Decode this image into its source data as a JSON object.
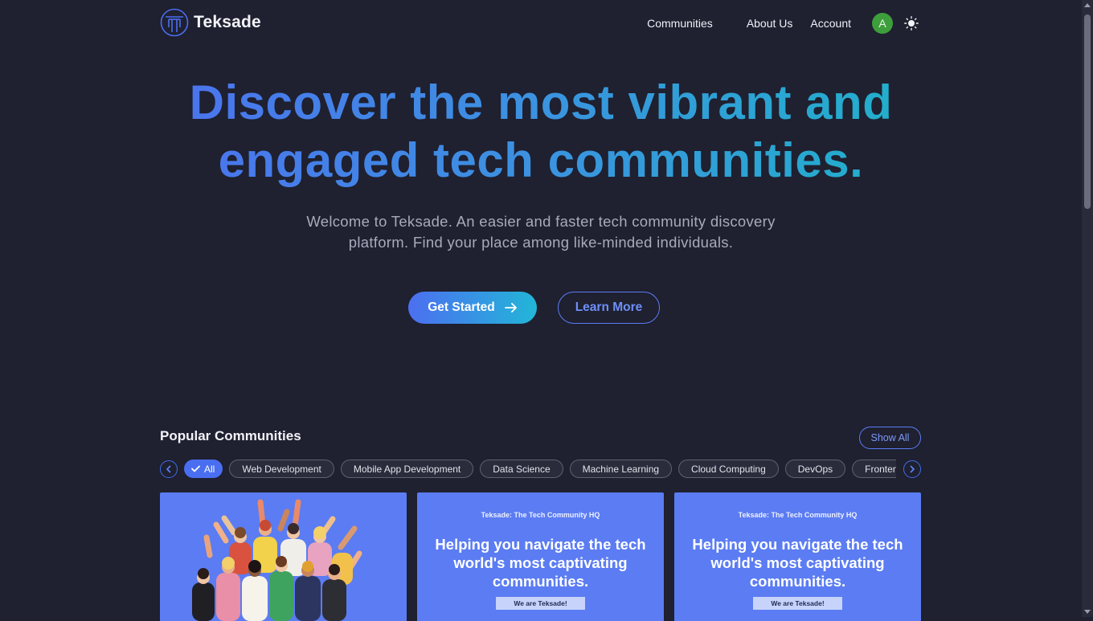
{
  "brand": {
    "name": "Teksade"
  },
  "nav": {
    "items": [
      "Communities",
      "About Us",
      "Account"
    ],
    "avatar_initial": "A"
  },
  "hero": {
    "title": "Discover the most vibrant and engaged tech communities.",
    "subtitle": "Welcome to Teksade. An easier and faster tech community discovery platform. Find your place among like-minded individuals.",
    "primary_cta": "Get Started",
    "secondary_cta": "Learn More"
  },
  "popular": {
    "title": "Popular Communities",
    "show_all": "Show All",
    "filters": [
      "All",
      "Web Development",
      "Mobile App Development",
      "Data Science",
      "Machine Learning",
      "Cloud Computing",
      "DevOps",
      "Frontend"
    ],
    "active_filter": "All",
    "cards": [
      {
        "type": "illustration"
      },
      {
        "kicker": "Teksade: The Tech Community HQ",
        "headline": "Helping you navigate the tech world's most captivating communities.",
        "tag": "We are Teksade!"
      },
      {
        "kicker": "Teksade: The Tech Community HQ",
        "headline": "Helping you navigate the tech world's most captivating communities.",
        "tag": "We are Teksade!"
      }
    ]
  },
  "colors": {
    "background": "#1f2030",
    "accent": "#4c6ff0",
    "accent_cyan": "#22b6d8",
    "card": "#5b7cf2",
    "avatar": "#3e9e3b"
  }
}
